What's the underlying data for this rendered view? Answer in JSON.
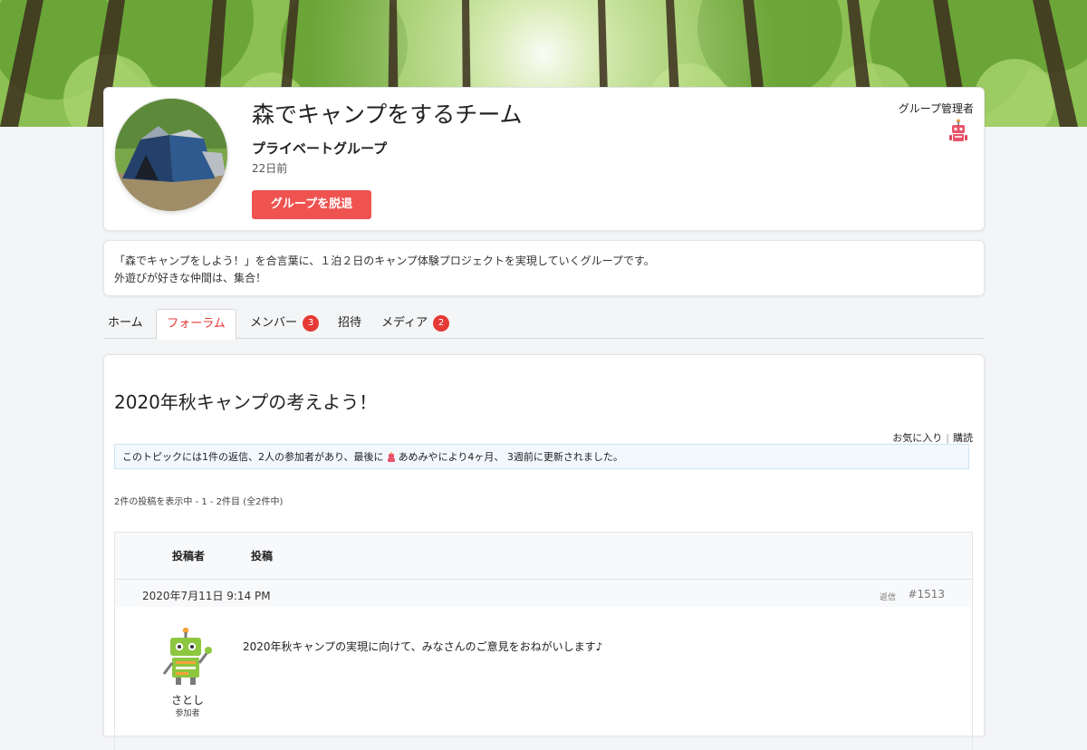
{
  "group": {
    "title": "森でキャンプをするチーム",
    "type": "プライベートグループ",
    "age": "22日前",
    "leave_button": "グループを脱退",
    "admin_label": "グループ管理者"
  },
  "description": {
    "line1": "「森でキャンプをしよう！」を合言葉に、１泊２日のキャンプ体験プロジェクトを実現していくグループです。",
    "line2": "外遊びが好きな仲間は、集合！"
  },
  "tabs": [
    {
      "label": "ホーム",
      "active": false
    },
    {
      "label": "フォーラム",
      "active": true
    },
    {
      "label": "メンバー",
      "badge": "3",
      "active": false
    },
    {
      "label": "招待",
      "active": false
    },
    {
      "label": "メディア",
      "badge": "2",
      "active": false
    }
  ],
  "topic": {
    "title": "2020年秋キャンプの考えよう！",
    "favorite_label": "お気に入り",
    "subscribe_label": "購読",
    "info_before": "このトピックには1件の返信、2人の参加者があり、最後に",
    "info_user": "あめみや",
    "info_after": "により4ヶ月、 3週前に更新されました。",
    "pagination": "2件の投稿を表示中 - 1 - 2件目 (全2件中)"
  },
  "table": {
    "col_author": "投稿者",
    "col_post": "投稿"
  },
  "post": {
    "date": "2020年7月11日 9:14 PM",
    "reply_label": "返信",
    "id": "#1513",
    "author_name": "さとし",
    "author_role": "参加者",
    "content": "2020年秋キャンプの実現に向けて、みなさんのご意見をおねがいします♪"
  },
  "colors": {
    "accent": "#e53935",
    "button": "#ef5350",
    "info_bg": "#f2f8fd"
  }
}
